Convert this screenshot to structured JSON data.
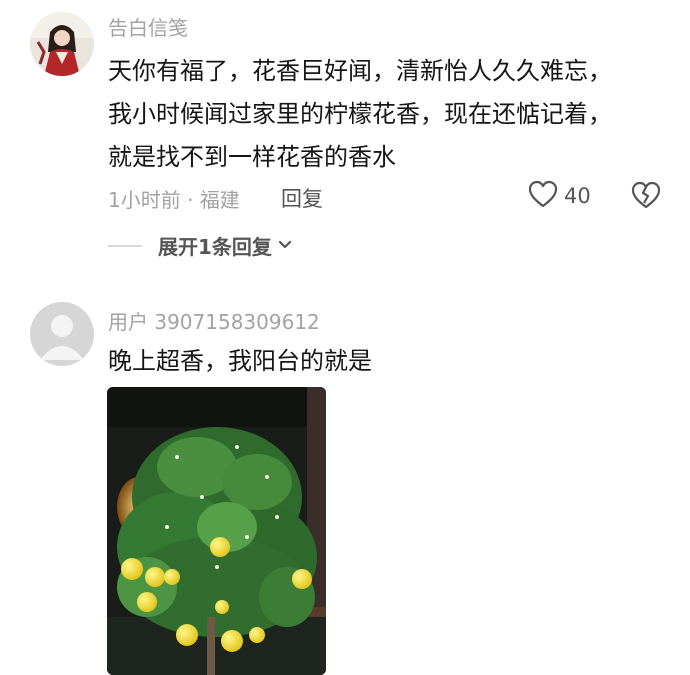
{
  "comments": [
    {
      "username": "告白信笺",
      "lines": [
        "天你有福了，花香巨好闻，清新怡人久久难忘，",
        "我小时候闻过家里的柠檬花香，现在还惦记着，",
        "就是找不到一样花香的香水"
      ],
      "meta": "1小时前 · 福建",
      "reply_label": "回复",
      "like_count": "40",
      "expand_label": "展开1条回复"
    },
    {
      "username": "用户 3907158309612",
      "lines": [
        "晚上超香，我阳台的就是"
      ]
    }
  ],
  "icons": {
    "like": "heart-outline-icon",
    "dislike": "broken-heart-icon",
    "expand": "chevron-down-icon"
  },
  "colors": {
    "text": "#161616",
    "muted": "#a3a3a3",
    "secondary": "#555555"
  }
}
